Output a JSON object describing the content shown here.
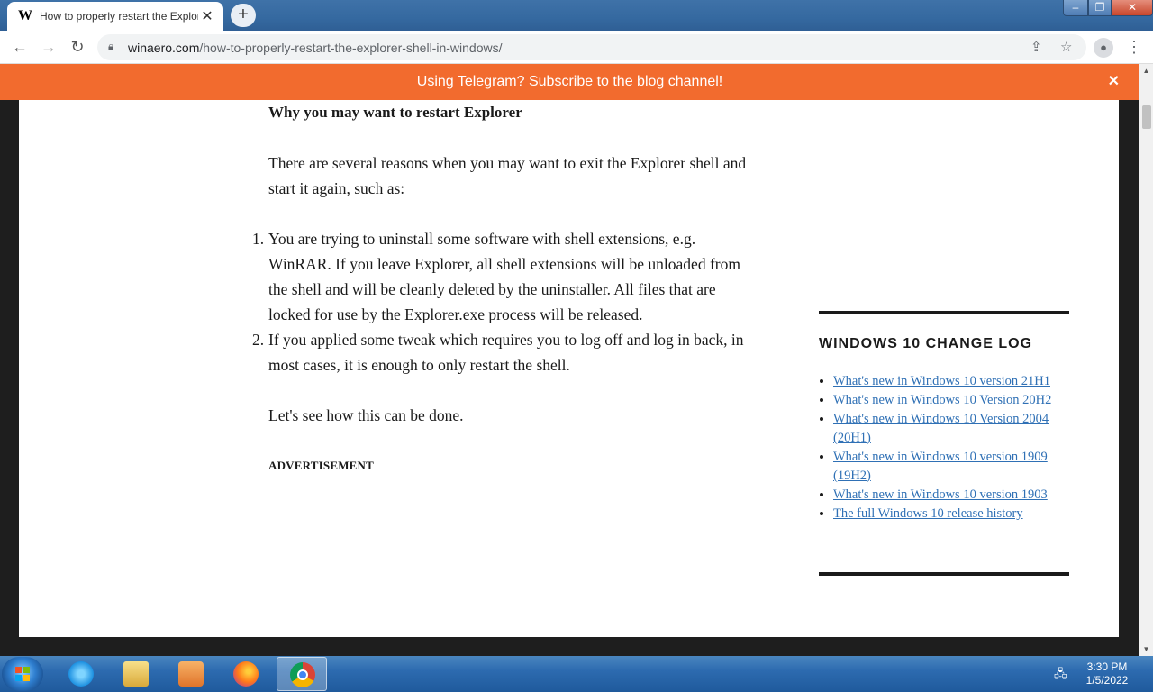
{
  "browser": {
    "tab": {
      "favicon": "W",
      "title": "How to properly restart the Explorer shell in Windows",
      "close_glyph": "✕"
    },
    "new_tab_glyph": "+",
    "address": {
      "domain": "winaero.com",
      "path": "/how-to-properly-restart-the-explorer-shell-in-windows/"
    },
    "nav_icons": [
      "back-arrow-icon",
      "forward-arrow-icon",
      "reload-icon"
    ],
    "address_icons": [
      "lock-icon",
      "share-icon",
      "star-icon"
    ],
    "window_controls": [
      "minimize",
      "maximize",
      "close"
    ]
  },
  "banner": {
    "text_before": "Using Telegram? Subscribe to the ",
    "link": "blog channel!",
    "close_glyph": "✕",
    "color": "#f26b2e"
  },
  "article": {
    "heading": "Why you may want to restart Explorer",
    "intro": "There are several reasons when you may want to exit the Explorer shell and start it again, such as:",
    "reasons": [
      {
        "num": "1.",
        "text": "You are trying to uninstall some software with shell extensions, e.g. WinRAR. If you leave Explorer, all shell extensions will be unloaded from the shell and will be cleanly deleted by the uninstaller. All files that are locked for use by the Explorer.exe process will be released."
      },
      {
        "num": "2.",
        "text": "If you applied some tweak which requires you to log off and log in back, in most cases, it is enough to only restart the shell."
      }
    ],
    "outro": "Let's see how this can be done.",
    "ad_label": "ADVERTISEMENT"
  },
  "sidebar": {
    "title": "WINDOWS 10 CHANGE LOG",
    "links": [
      "What's new in Windows 10 version 21H1",
      "What's new in Windows 10 Version 20H2",
      "What's new in Windows 10 Version 2004 (20H1)",
      "What's new in Windows 10 version 1909 (19H2)",
      "What's new in Windows 10 version 1903",
      "The full Windows 10 release history"
    ],
    "link_color": "#2f70b5"
  },
  "taskbar": {
    "apps": [
      "internet-explorer",
      "file-explorer",
      "media-player",
      "firefox",
      "chrome"
    ],
    "active_app": "chrome",
    "time": "3:30 PM",
    "date": "1/5/2022"
  }
}
